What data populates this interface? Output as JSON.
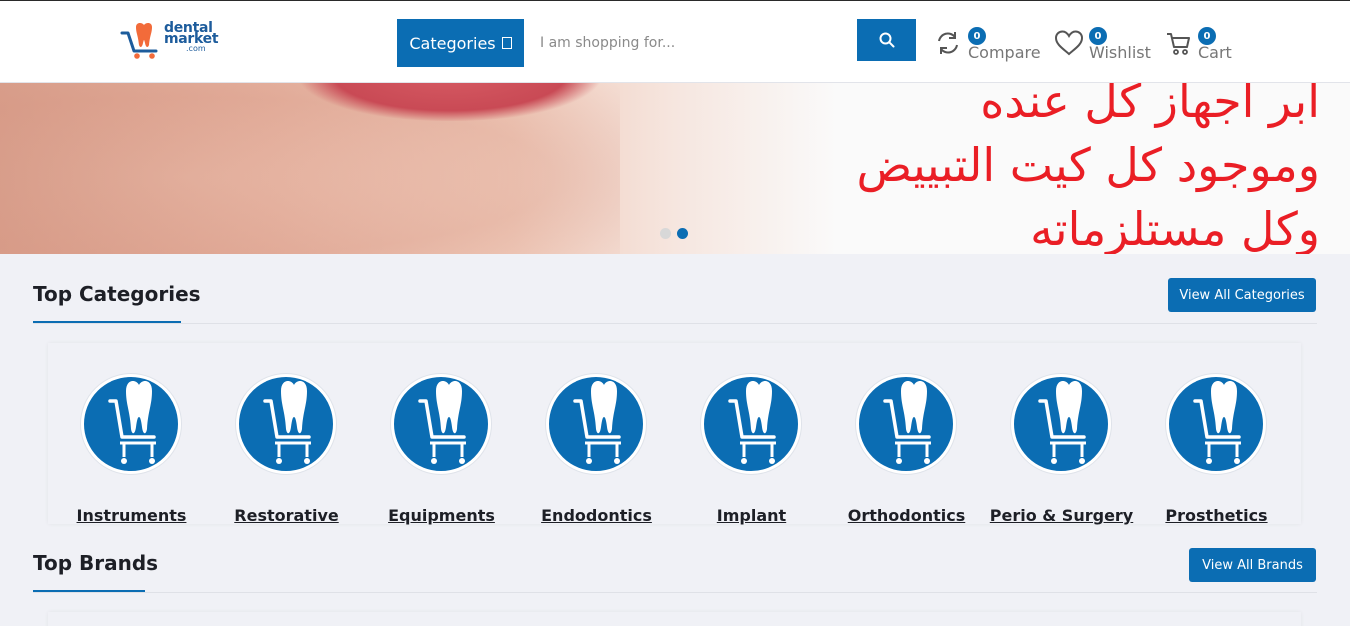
{
  "header": {
    "logo": {
      "line1": "dental",
      "line2": "market",
      "line3": ".com"
    },
    "categories_button": "Categories",
    "search": {
      "placeholder": "I am shopping for...",
      "value": ""
    },
    "actions": [
      {
        "label": "Compare",
        "count": "0",
        "icon": "compare-icon"
      },
      {
        "label": "Wishlist",
        "count": "0",
        "icon": "heart-icon"
      },
      {
        "label": "Cart",
        "count": "0",
        "icon": "cart-icon"
      }
    ]
  },
  "banner": {
    "lines": [
      "ابر اجهاز كل عنده",
      "وموجود كل كيت التبييض",
      "وكل مستلزماته"
    ],
    "active_slide": 2,
    "slides": 2
  },
  "top_categories": {
    "title": "Top Categories",
    "view_all": "View All Categories",
    "items": [
      {
        "name": "Instruments"
      },
      {
        "name": "Restorative"
      },
      {
        "name": "Equipments"
      },
      {
        "name": "Endodontics"
      },
      {
        "name": "Implant"
      },
      {
        "name": "Orthodontics"
      },
      {
        "name": "Perio & Surgery"
      },
      {
        "name": "Prosthetics"
      }
    ]
  },
  "top_brands": {
    "title": "Top Brands",
    "view_all": "View All Brands"
  },
  "colors": {
    "primary": "#0b6db3",
    "banner_text": "#ea1e25",
    "background": "#f0f1f6"
  }
}
